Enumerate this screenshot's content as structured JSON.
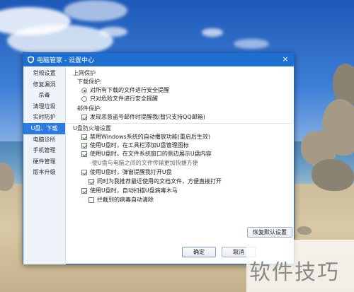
{
  "window": {
    "title": "电脑管家 - 设置中心",
    "close_glyph": "×"
  },
  "sidebar": {
    "items": [
      {
        "label": "常规设置",
        "active": false
      },
      {
        "label": "修复漏洞",
        "active": false
      },
      {
        "label": "杀毒",
        "active": false
      },
      {
        "label": "清理垃圾",
        "active": false
      },
      {
        "label": "实时防护",
        "active": false
      },
      {
        "label": "U盘、下载",
        "active": true
      },
      {
        "label": "电脑诊所",
        "active": false
      },
      {
        "label": "手机管理",
        "active": false
      },
      {
        "label": "硬件管理",
        "active": false
      },
      {
        "label": "版本升级",
        "active": false
      }
    ]
  },
  "content": {
    "online_protection": "上网保护",
    "download_protection": "下载保护:",
    "radio_all": "对所有下载的文件进行安全提醒",
    "radio_dangerous": "只对危险文件进行安全提醒",
    "selected_radio": "radio_all",
    "mail_protection": "邮件保护:",
    "mail_warning": "发现恶意盗号邮件时提醒我(暂只支持QQ邮箱)",
    "usb_settings": "U盘防火墙设置",
    "usb_disable_autoplay": "禁用Windows系统的自动播放功能(重启后生效)",
    "usb_toolbar_icon": "使用U盘时，在工具栏添加U盘管理图标",
    "usb_side_window": "使用U盘时，在文件系统窗口的侧边展示U盘内容",
    "usb_side_hint": "-使U盘与电脑之间的文件传输更加快捷方便",
    "usb_popup_reminder": "使用U盘时，弹窗提醒我打开U盘",
    "usb_recent_files": "同时为我推荐最近使用的文档文件，方便直接打开",
    "usb_auto_scan": "使用U盘时，自动扫描U盘病毒木马",
    "usb_auto_clean": "拦截到的病毒自动清除"
  },
  "checkbox_states": {
    "mail_warning": true,
    "usb_disable_autoplay": true,
    "usb_toolbar_icon": true,
    "usb_side_window": true,
    "usb_popup_reminder": true,
    "usb_recent_files": true,
    "usb_auto_scan": true,
    "usb_auto_clean": false
  },
  "buttons": {
    "restore_defaults": "恢复默认设置",
    "ok": "确定",
    "cancel": "取消"
  },
  "watermark": {
    "text": "软件技巧"
  },
  "colors": {
    "titlebar": "#1e6fd0",
    "active_tab": "#2d7be0",
    "check_green": "#2a8a2a"
  }
}
